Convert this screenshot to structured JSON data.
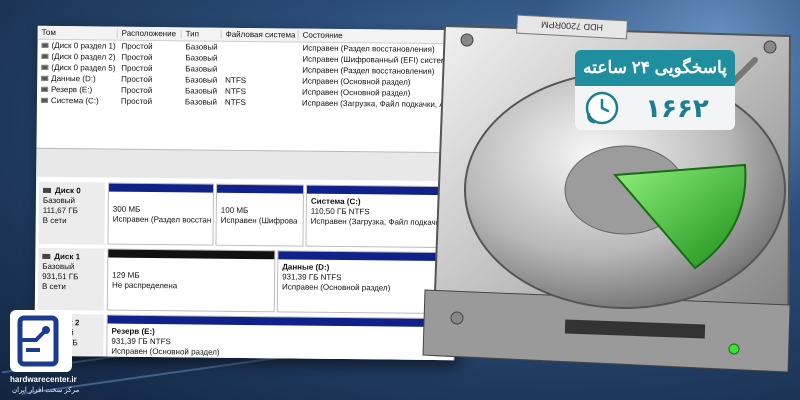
{
  "volumes": {
    "headers": [
      "Том",
      "Расположение",
      "Тип",
      "Файловая система",
      "Состояние"
    ],
    "rows": [
      [
        "(Диск 0 раздел 1)",
        "Простой",
        "Базовый",
        "",
        "Исправен (Раздел восстановления)"
      ],
      [
        "(Диск 0 раздел 2)",
        "Простой",
        "Базовый",
        "",
        "Исправен (Шифрованный (EFI) системн"
      ],
      [
        "(Диск 0 раздел 5)",
        "Простой",
        "Базовый",
        "",
        "Исправен (Раздел восстановления)"
      ],
      [
        "Данные (D:)",
        "Простой",
        "Базовый",
        "NTFS",
        "Исправен (Основной раздел)"
      ],
      [
        "Резерв (E:)",
        "Простой",
        "Базовый",
        "NTFS",
        "Исправен (Основной раздел)"
      ],
      [
        "Система (C:)",
        "Простой",
        "Базовый",
        "NTFS",
        "Исправен (Загрузка, Файл подкачки, А"
      ]
    ]
  },
  "disks": [
    {
      "name": "Диск 0",
      "type": "Базовый",
      "size": "111,67 ГБ",
      "status": "В сети",
      "partitions": [
        {
          "title": "",
          "size": "300 МБ",
          "status": "Исправен (Раздел восстан",
          "bar": "blue"
        },
        {
          "title": "",
          "size": "100 МБ",
          "status": "Исправен (Шифрова",
          "bar": "blue"
        },
        {
          "title": "Система (C:)",
          "size": "110,50 ГБ NTFS",
          "status": "Исправен (Загрузка, Файл подкачи",
          "bar": "blue"
        }
      ]
    },
    {
      "name": "Диск 1",
      "type": "Базовый",
      "size": "931,51 ГБ",
      "status": "В сети",
      "partitions": [
        {
          "title": "",
          "size": "129 МБ",
          "status": "Не распределена",
          "bar": "black"
        },
        {
          "title": "Данные (D:)",
          "size": "931,39 ГБ NTFS",
          "status": "Исправен (Основной раздел)",
          "bar": "blue"
        }
      ]
    },
    {
      "name": "Диск 2",
      "type": "Базовый",
      "size": "931,39 ГБ",
      "status": "",
      "partitions": [
        {
          "title": "Резерв (E:)",
          "size": "931,39 ГБ NTFS",
          "status": "Исправен (Основной раздел)",
          "bar": "blue"
        }
      ]
    }
  ],
  "hdd": {
    "label": "HDD 7200RPM"
  },
  "badge": {
    "title": "پاسخگویی ۲۴ ساعته",
    "number": "۱۶۶۲"
  },
  "logo": {
    "site": "hardwarecenter.ir",
    "tagline": "مرکز سخت افزار ایران"
  },
  "colors": {
    "badge_teal": "#1f8fa0",
    "partition_blue": "#10218c",
    "pie_green": "#3fbf2f",
    "led_green": "#39e23a"
  }
}
